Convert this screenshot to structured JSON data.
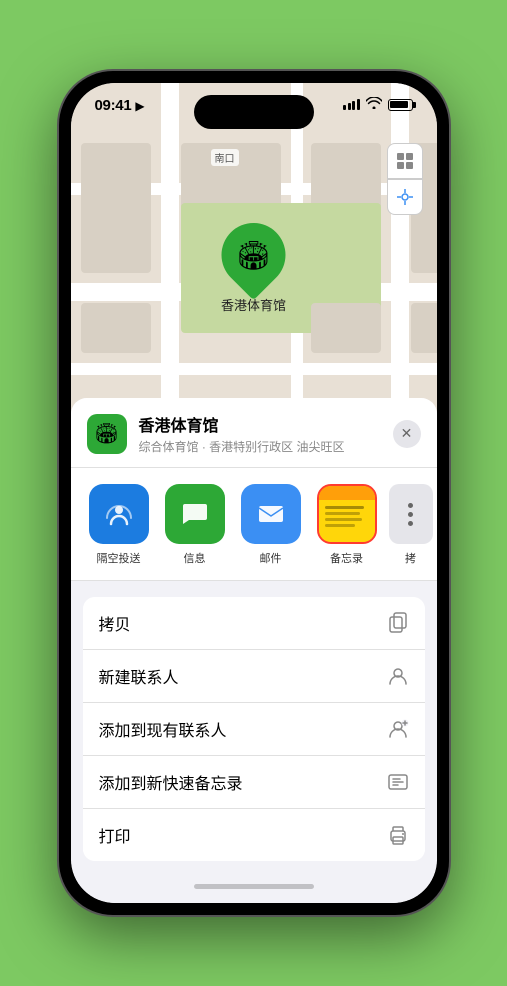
{
  "statusBar": {
    "time": "09:41",
    "locationArrow": "▶"
  },
  "map": {
    "label": "南口"
  },
  "locationPin": {
    "emoji": "🏟",
    "name": "香港体育馆"
  },
  "locationHeader": {
    "name": "香港体育馆",
    "sub": "综合体育馆 · 香港特别行政区 油尖旺区",
    "closeLabel": "✕"
  },
  "shareItems": [
    {
      "id": "airdrop",
      "label": "隔空投送",
      "emoji": "📡"
    },
    {
      "id": "messages",
      "label": "信息",
      "emoji": "💬"
    },
    {
      "id": "mail",
      "label": "邮件",
      "emoji": "✉️"
    },
    {
      "id": "notes",
      "label": "备忘录",
      "emoji": ""
    },
    {
      "id": "more",
      "label": "拷",
      "emoji": "···"
    }
  ],
  "actionItems": [
    {
      "id": "copy",
      "label": "拷贝",
      "icon": "⎘"
    },
    {
      "id": "new-contact",
      "label": "新建联系人",
      "icon": "👤"
    },
    {
      "id": "add-existing",
      "label": "添加到现有联系人",
      "icon": "👤"
    },
    {
      "id": "add-notes",
      "label": "添加到新快速备忘录",
      "icon": "📝"
    },
    {
      "id": "print",
      "label": "打印",
      "icon": "🖨"
    }
  ]
}
